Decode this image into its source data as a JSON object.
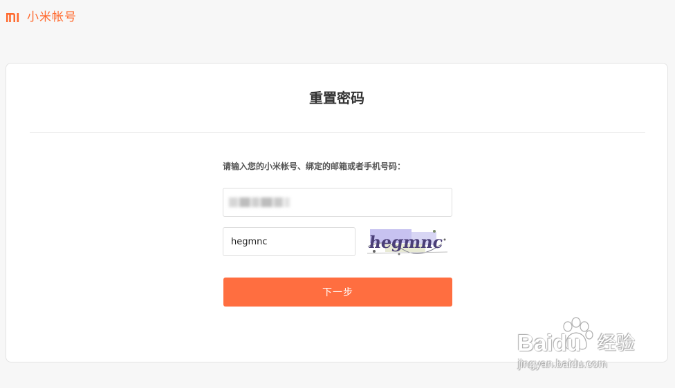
{
  "header": {
    "logo_icon": "mi-logo-icon",
    "brand": "小米帐号"
  },
  "card": {
    "title": "重置密码",
    "prompt": "请输入您的小米帐号、绑定的邮箱或者手机号码：",
    "account_input": {
      "value": "",
      "note": "masked"
    },
    "captcha_input": {
      "value": "hegmnc"
    },
    "captcha_image": {
      "text": "hegmnc"
    },
    "next_button": "下一步"
  },
  "watermark": {
    "brand": "Baidu",
    "cn": "经验",
    "url": "jingyan.baidu.com"
  },
  "colors": {
    "accent": "#ff6e40",
    "brand": "#ff6a2e"
  }
}
